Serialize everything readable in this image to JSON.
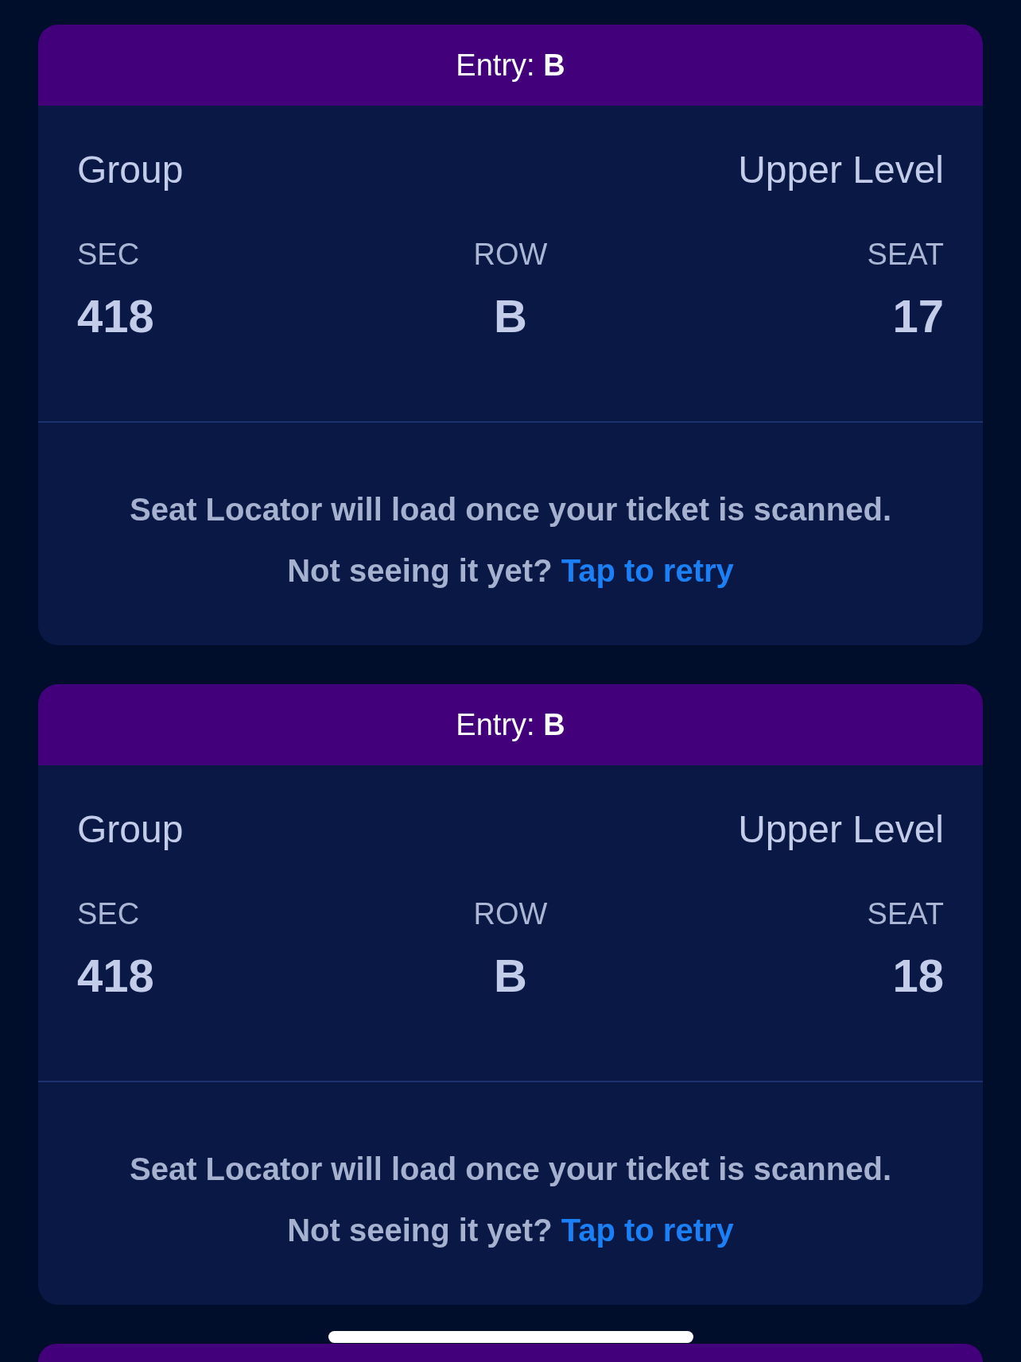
{
  "tickets": [
    {
      "kind": "full",
      "entry": "Entry: **B**",
      "group": "Group",
      "area": "Upper Level",
      "seat_info": [
        {
          "label": "SEC",
          "value": "418"
        },
        {
          "label": "ROW",
          "value": "B"
        },
        {
          "label": "SEAT",
          "value": "17"
        }
      ],
      "locator_message": "Seat Locator will load once your ticket is scanned.",
      "retry_prompt": "Not seeing it yet?",
      "retry_link": "Tap to retry"
    },
    {
      "kind": "full",
      "entry": "Entry: **B**",
      "group": "Group",
      "area": "Upper Level",
      "seat_info": [
        {
          "label": "SEC",
          "value": "418"
        },
        {
          "label": "ROW",
          "value": "B"
        },
        {
          "label": "SEAT",
          "value": "18"
        }
      ],
      "locator_message": "Seat Locator will load once your ticket is scanned.",
      "retry_prompt": "Not seeing it yet?",
      "retry_link": "Tap to retry"
    },
    {
      "kind": "cut_off"
    }
  ],
  "home_indicator": true
}
